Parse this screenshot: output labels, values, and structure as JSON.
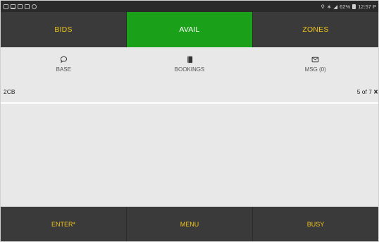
{
  "status_bar": {
    "right_text": "62%",
    "time": "12:57 P"
  },
  "top_tabs": [
    {
      "label": "BIDS",
      "active": false
    },
    {
      "label": "AVAIL",
      "active": true
    },
    {
      "label": "ZONES",
      "active": false
    }
  ],
  "sub_nav": [
    {
      "label": "BASE",
      "icon": "chat-bubble-icon"
    },
    {
      "label": "BOOKINGS",
      "icon": "book-icon"
    },
    {
      "label": "MSG (0)",
      "icon": "envelope-icon"
    }
  ],
  "info": {
    "code": "2CB",
    "pager": "5 of 7",
    "pager_icon": "close-icon"
  },
  "bottom_bar": [
    {
      "label": "ENTER*"
    },
    {
      "label": "MENU"
    },
    {
      "label": "BUSY"
    }
  ],
  "colors": {
    "active_tab": "#1aa119",
    "accent_text": "#f0c419",
    "bar_background": "#3a3a3a"
  }
}
